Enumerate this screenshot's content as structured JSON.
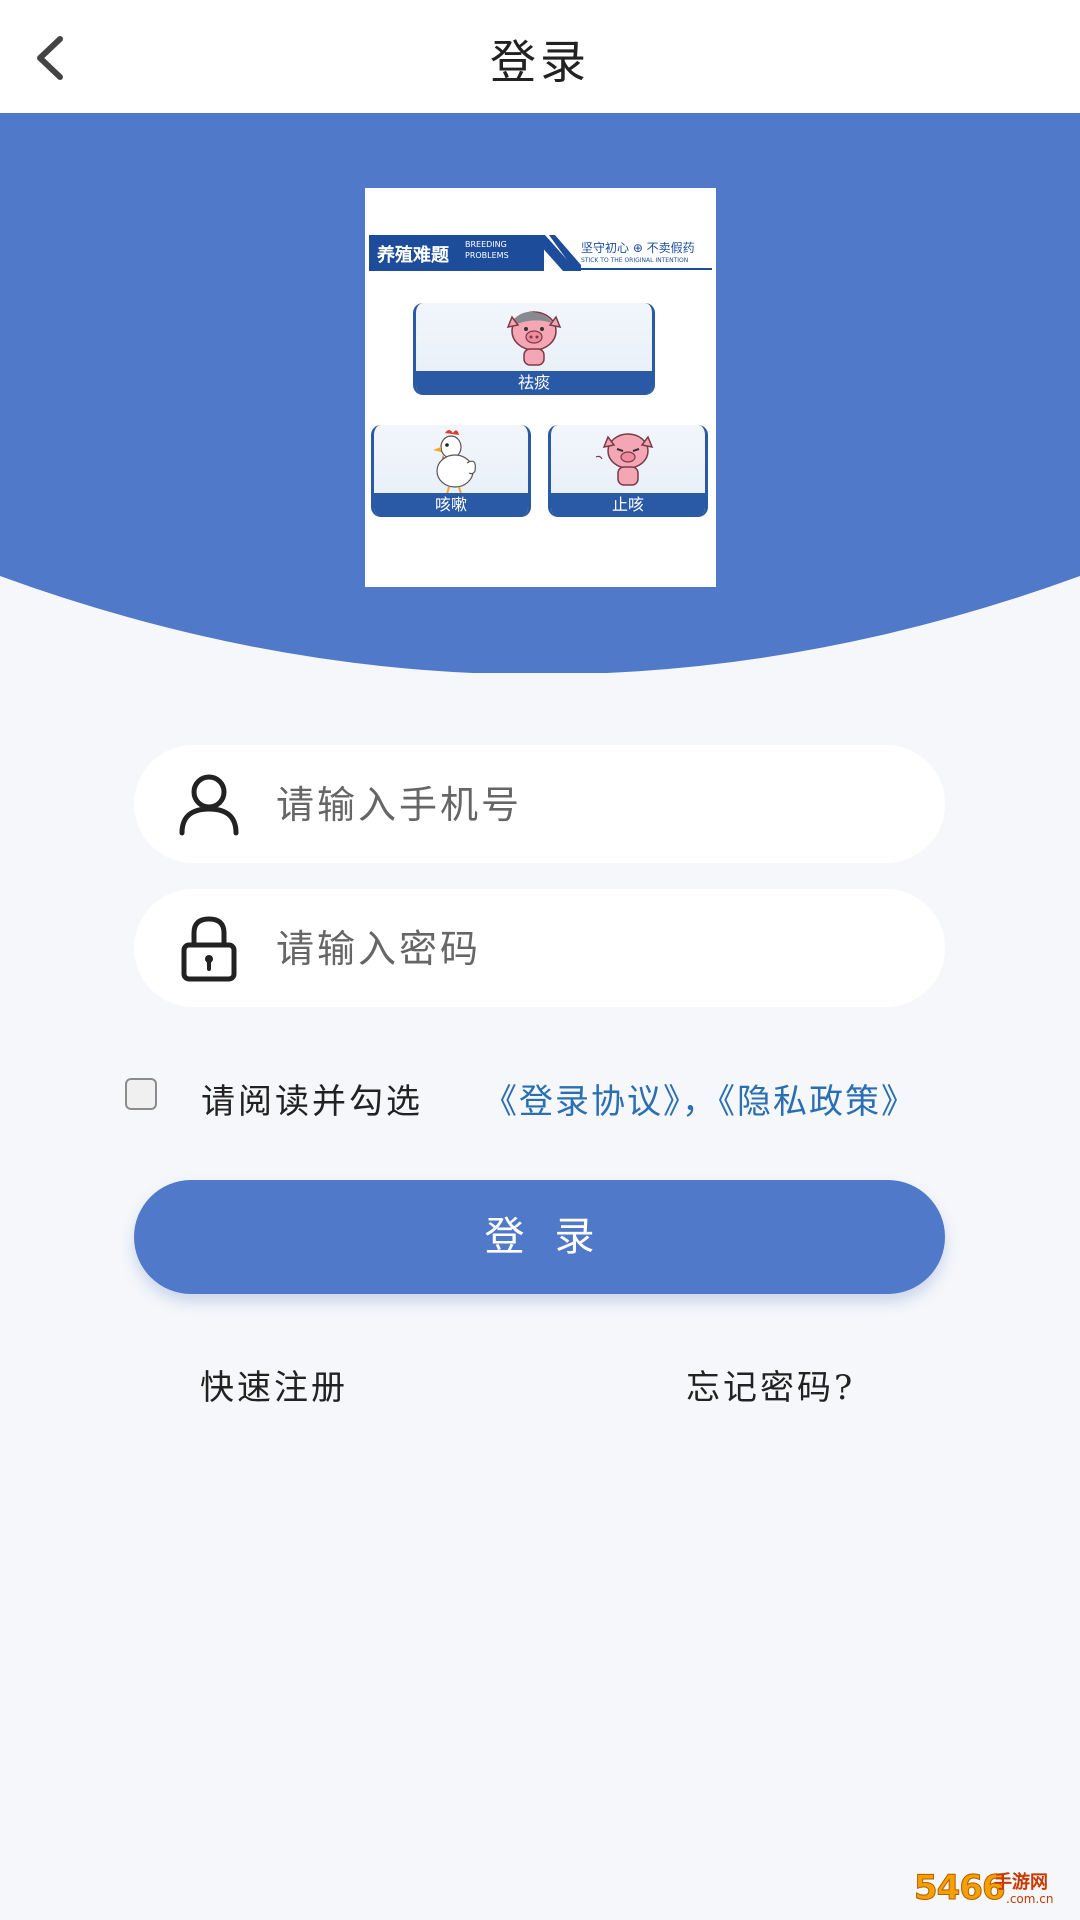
{
  "header": {
    "title": "登录"
  },
  "banner": {
    "color": "#5079c9",
    "logo": {
      "strip_title": "养殖难题",
      "strip_title_en": "BREEDING PROBLEMS",
      "slogan_cn": "坚守初心 ⊕ 不卖假药",
      "slogan_en": "STICK TO THE ORIGINAL INTENTION",
      "tiles": [
        {
          "label": "祛痰",
          "icon": "pig-icon"
        },
        {
          "label": "咳嗽",
          "icon": "chicken-icon"
        },
        {
          "label": "止咳",
          "icon": "pig-icon"
        }
      ]
    }
  },
  "form": {
    "phone": {
      "placeholder": "请输入手机号",
      "value": "",
      "icon": "user-icon"
    },
    "password": {
      "placeholder": "请输入密码",
      "value": "",
      "icon": "lock-icon"
    },
    "agreement": {
      "checked": false,
      "text": "请阅读并勾选",
      "link_login": "《登录协议》",
      "separator": "，",
      "link_privacy": "《隐私政策》"
    },
    "submit_label": "登录"
  },
  "links": {
    "register": "快速注册",
    "forgot": "忘记密码?"
  },
  "watermark": {
    "number": "5466",
    "brand": "手游网",
    "domain": ".com.cn"
  },
  "colors": {
    "accent": "#5079c9",
    "link": "#2b6fb3",
    "background": "#f5f7fa"
  }
}
